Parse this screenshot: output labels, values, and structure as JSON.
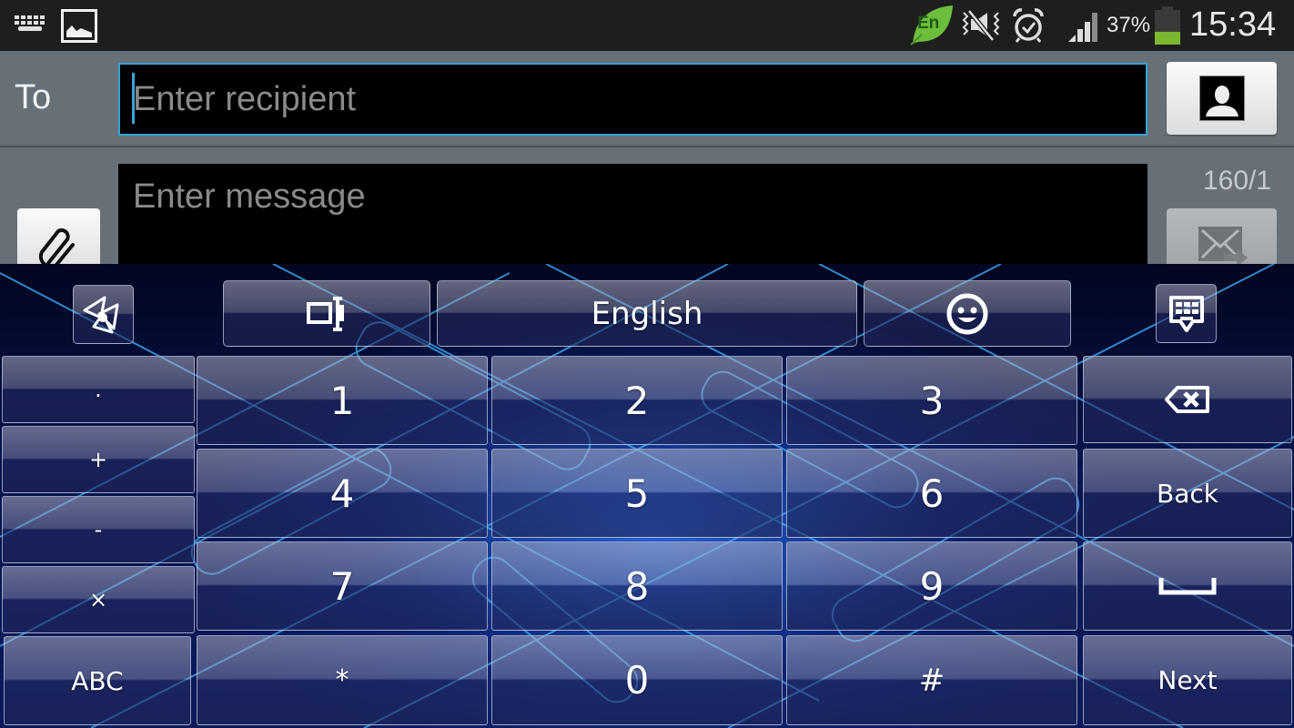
{
  "status_bar": {
    "left_icons": [
      "keyboard-icon",
      "image-icon"
    ],
    "input_lang_badge": "En",
    "right_icons": [
      "language-leaf-icon",
      "mute-vibrate-icon",
      "alarm-icon",
      "signal-icon",
      "battery-icon"
    ],
    "battery_percent_text": "37%",
    "battery_level": 0.37,
    "time": "15:34",
    "colors": {
      "battery_fill": "#7cb82f",
      "lang_badge": "#6cbd3c"
    }
  },
  "compose": {
    "to_label": "To",
    "recipient_value": "",
    "recipient_placeholder": "Enter recipient",
    "message_value": "",
    "message_placeholder": "Enter message",
    "char_counter": "160/1",
    "contact_button_icon": "contact-icon",
    "attach_button_icon": "paperclip-icon",
    "send_button_icon": "send-message-icon",
    "colors": {
      "focus_border": "#33a4d8",
      "background": "#687077"
    }
  },
  "keyboard": {
    "top_row": {
      "settings_icon": "keyboard-settings-icon",
      "cursor_icon": "text-cursor-icon",
      "language_label": "English",
      "emoji_icon": "emoji-icon",
      "hide_icon": "hide-keyboard-icon"
    },
    "left_column": [
      ".",
      "+",
      "-",
      "×",
      "ABC"
    ],
    "digits": [
      [
        "1",
        "2",
        "3"
      ],
      [
        "4",
        "5",
        "6"
      ],
      [
        "7",
        "8",
        "9"
      ],
      [
        "*",
        "0",
        "#"
      ]
    ],
    "right_column": {
      "delete_icon": "backspace-icon",
      "back_label": "Back",
      "space_icon": "space-icon",
      "next_label": "Next"
    }
  }
}
